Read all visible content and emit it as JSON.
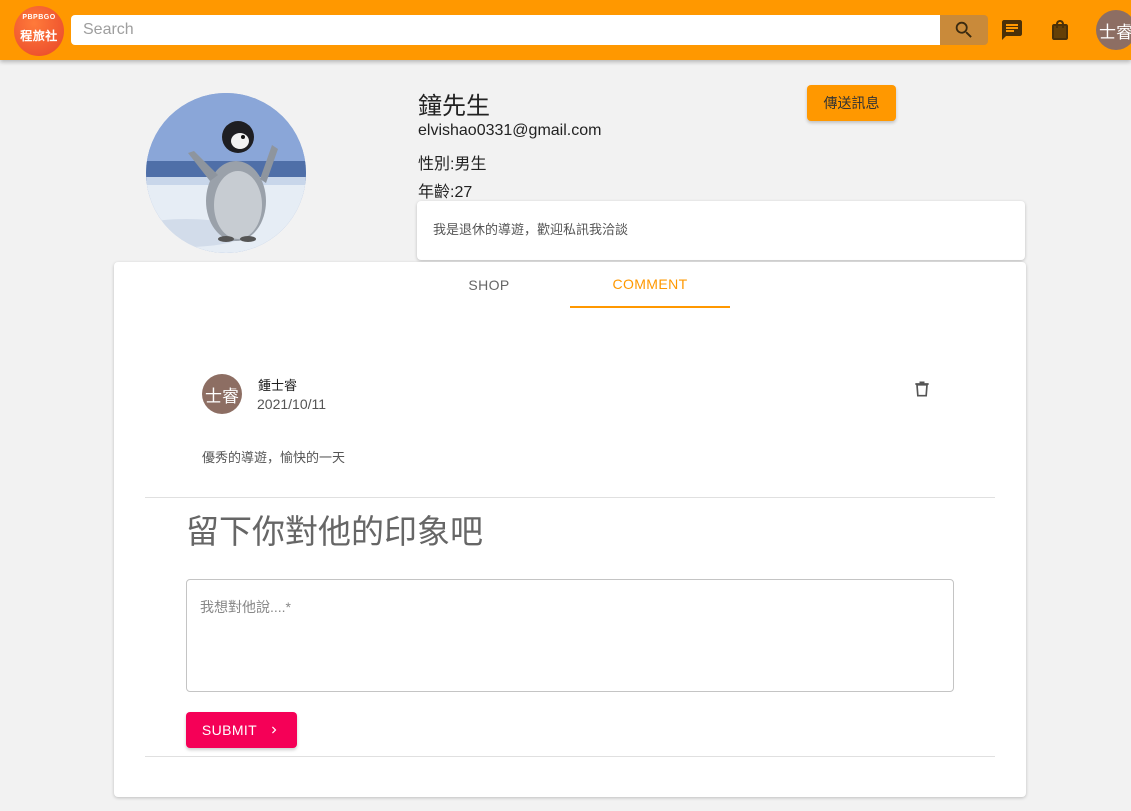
{
  "header": {
    "logo_line1": "PBPBGO",
    "logo_line2": "程旅社",
    "search_placeholder": "Search",
    "user_avatar_text": "士睿",
    "accent_color": "#ff9800"
  },
  "profile": {
    "name": "鐘先生",
    "email": "elvishao0331@gmail.com",
    "gender": "性別:男生",
    "age": "年齡:27",
    "message_button": "傳送訊息",
    "bio": "我是退休的導遊，歡迎私訊我洽談"
  },
  "tabs": [
    {
      "label": "SHOP",
      "active": false
    },
    {
      "label": "COMMENT",
      "active": true
    }
  ],
  "comments": [
    {
      "avatar_text": "士睿",
      "author": "鍾士睿",
      "date": "2021/10/11",
      "text": "優秀的導遊，愉快的一天"
    }
  ],
  "comment_form": {
    "title": "留下你對他的印象吧",
    "placeholder": "我想對他說....*",
    "submit_label": "SUBMIT"
  }
}
